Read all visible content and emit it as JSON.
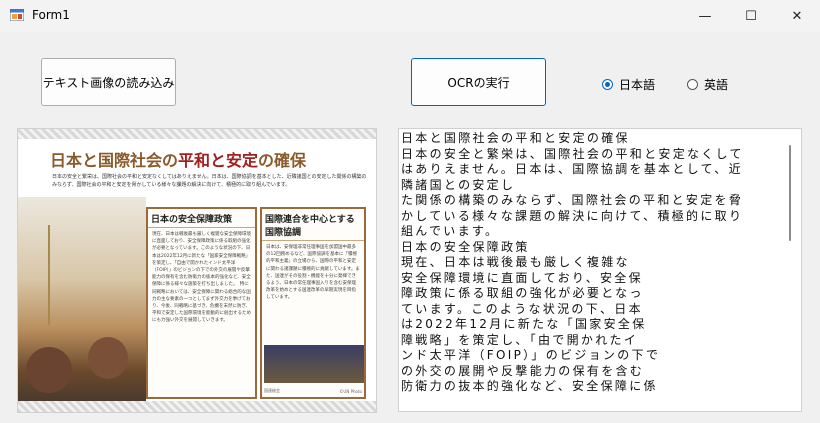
{
  "window": {
    "title": "Form1",
    "controls": {
      "minimize": "—",
      "maximize": "☐",
      "close": "✕"
    }
  },
  "toolbar": {
    "load_image_label": "テキスト画像の読み込み",
    "run_ocr_label": "OCRの実行"
  },
  "language": {
    "selected": "japanese",
    "options": [
      {
        "id": "japanese",
        "label": "日本語",
        "checked": true
      },
      {
        "id": "english",
        "label": "英語",
        "checked": false
      }
    ]
  },
  "image_preview": {
    "title_part1": "日本と国際社会の",
    "title_part2": "平和と安定",
    "title_part3": "の確保",
    "lead": "日本の安全と繁栄は、国際社会の平和と安定なくしてはありえません。日本は、国際協調を基本とした、近隣諸国との安定した関係の構築のみならず、国際社会の平和と安定を脅かしている様々な課題の解決に向けて、積極的に取り組んでいます。",
    "box1_title": "日本の安全保障政策",
    "box1_body": "現在、日本は戦後最も厳しく複雑な安全保障環境に直面しており、安全保障政策に係る取組の強化が必要となっています。このような状況の下、日本は2022年12月に新たな「国家安全保障戦略」を策定し、「自由で開かれたインド太平洋（FOIP）」のビジョンの下での外交の展開や反撃能力の保有を含む防衛力の抜本的強化など、安全保障に係る様々な施策を打ち出しました。　特に同戦略においては、安全保障に関わる総合的な国力の主な要素の一つとしてまず外交力を挙げており、今後、同戦略に基づき、危機を未然に防ぎ、平和で安定した国際環境を能動的に創出するためにも力強い外交を展開していきます。",
    "box2_title": "国際連合を中心とする国際協調",
    "box2_body": "日本は、安保理非常任理事国を加盟国中最多の12回務めるなど、国際協調を基本に「積極的平和主義」の立場から、国際の平和と安定に関わる諸課題に積極的に貢献しています。また、国連がその役割・機能を十分に発揮できるよう、日本の常任理事国入りを含む安保理改革を始めとする国連改革の早期実現を目指しています。",
    "box2_caption": "国連総会",
    "box2_credit": "©UN Photo"
  },
  "ocr_output": {
    "lines": [
      "日本と国際社会の平和と安定の確保",
      "日本の安全と繁栄は、国際社会の平和と安定なくして",
      "はありえません。日本は、国際協調を基本として、近",
      "隣諸国との安定し",
      "た関係の構築のみならず、国際社会の平和と安定を脅",
      "かしている様々な課題の解決に向けて、積極的に取り",
      "組んでいます。",
      "日本の安全保障政策",
      "現在、日本は戦後最も厳しく複雑な",
      "安全保障環境に直面しており、安全保",
      "障政策に係る取組の強化が必要となっ",
      "ています。このような状況の下、日本",
      "は2022年12月に新たな「国家安全保",
      "障戦略」を策定し、「由で開かれたイ",
      "ンド太平洋（FOIP）」のビジョンの下で",
      "の外交の展開や反撃能力の保有を含む",
      "防衛力の抜本的強化など、安全保障に係"
    ]
  }
}
